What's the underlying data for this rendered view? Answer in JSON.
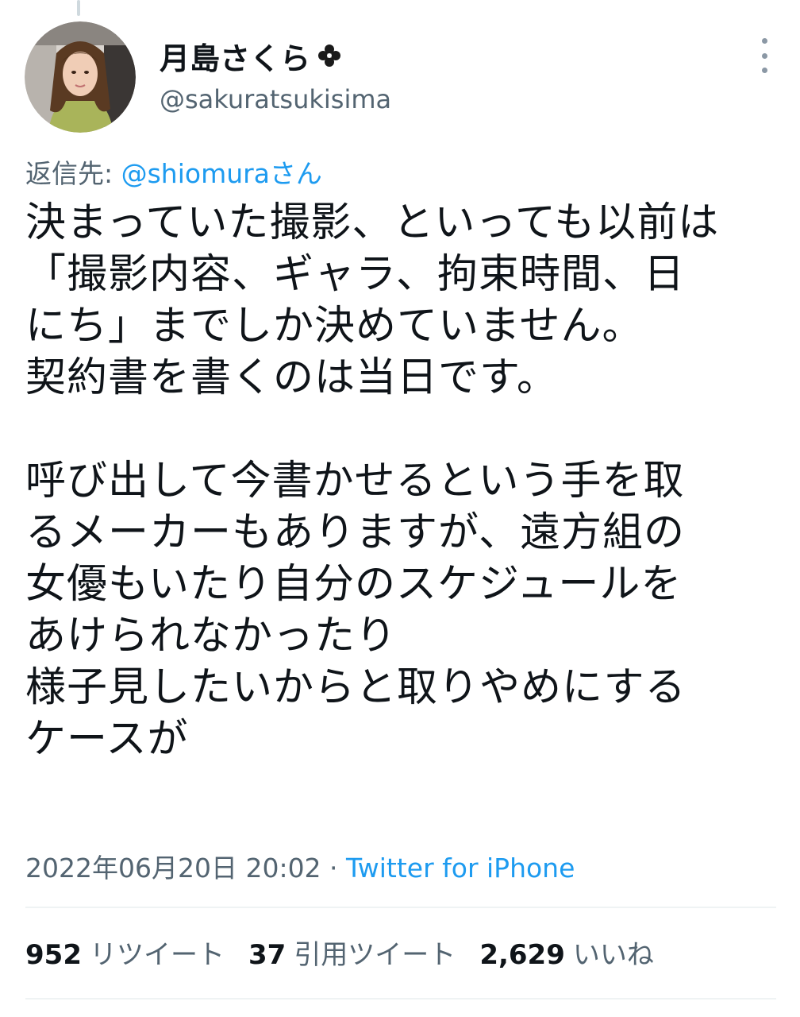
{
  "author": {
    "display_name": "月島さくら",
    "name_emoji": "clover-icon",
    "handle": "@sakuratsukisima",
    "avatar": "profile-photo"
  },
  "reply": {
    "prefix": "返信先: ",
    "mention": "@shiomuraさん"
  },
  "tweet": {
    "lines": [
      "決まっていた撮影、といっても以前は",
      "「撮影内容、ギャラ、拘束時間、日",
      "にち」までしか決めていません。",
      "契約書を書くのは当日です。",
      "",
      "呼び出して今書かせるという手を取",
      "るメーカーもありますが、遠方組の",
      "女優もいたり自分のスケジュールを",
      "あけられなかったり",
      "様子見したいからと取りやめにする",
      "ケースが"
    ]
  },
  "meta": {
    "timestamp": "2022年06月20日 20:02",
    "separator": " · ",
    "source": "Twitter for iPhone"
  },
  "stats": {
    "retweets_count": "952",
    "retweets_label": "リツイート",
    "quotes_count": "37",
    "quotes_label": "引用ツイート",
    "likes_count": "2,629",
    "likes_label": "いいね"
  },
  "colors": {
    "accent": "#1d9bf0",
    "secondary_text": "#536471",
    "primary_text": "#0f1419"
  }
}
